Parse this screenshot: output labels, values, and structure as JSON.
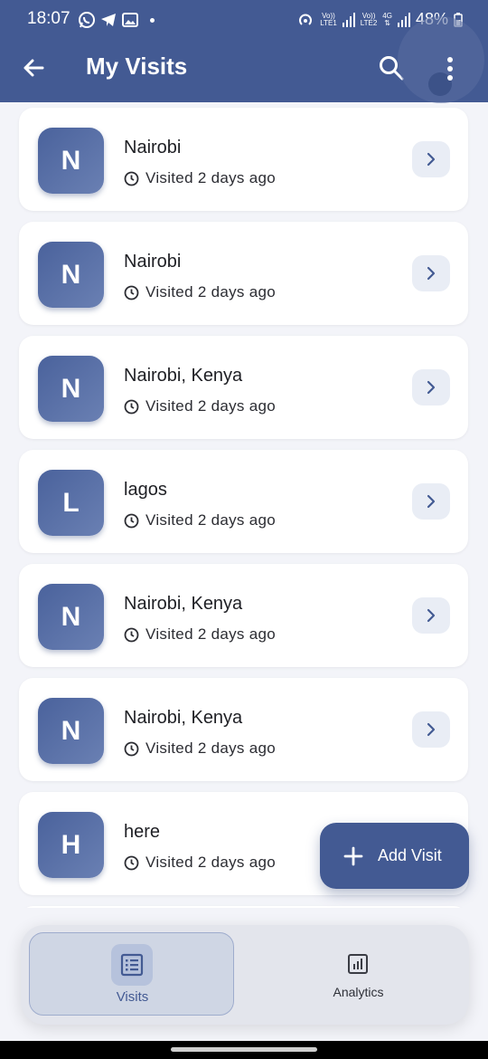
{
  "status_bar": {
    "time": "18:07",
    "battery": "48%",
    "net1": "LTE1",
    "net2": "LTE2",
    "net_type": "4G",
    "volte": "Vo))"
  },
  "app_bar": {
    "title": "My Visits",
    "back_icon": "arrow-left-icon",
    "search_icon": "search-icon",
    "more_icon": "more-vertical-icon",
    "color": "#435a93"
  },
  "visits": [
    {
      "initial": "N",
      "title": "Nairobi",
      "subtitle": "Visited 2 days ago"
    },
    {
      "initial": "N",
      "title": "Nairobi",
      "subtitle": "Visited 2 days ago"
    },
    {
      "initial": "N",
      "title": "Nairobi, Kenya",
      "subtitle": "Visited 2 days ago"
    },
    {
      "initial": "L",
      "title": "lagos",
      "subtitle": "Visited 2 days ago"
    },
    {
      "initial": "N",
      "title": "Nairobi, Kenya",
      "subtitle": "Visited 2 days ago"
    },
    {
      "initial": "N",
      "title": "Nairobi, Kenya",
      "subtitle": "Visited 2 days ago"
    },
    {
      "initial": "H",
      "title": "here",
      "subtitle": "Visited 2 days ago"
    }
  ],
  "fab": {
    "label": "Add Visit",
    "icon": "plus-icon"
  },
  "bottom_nav": {
    "items": [
      {
        "label": "Visits",
        "icon": "list-icon",
        "selected": true
      },
      {
        "label": "Analytics",
        "icon": "bar-chart-icon",
        "selected": false
      }
    ]
  }
}
